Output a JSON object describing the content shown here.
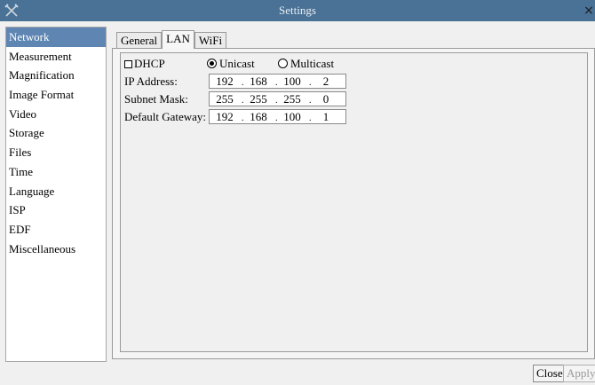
{
  "window": {
    "title": "Settings",
    "icon": "tools-icon",
    "close_icon": "close-icon",
    "close_glyph": "×"
  },
  "sidebar": {
    "items": [
      {
        "label": "Network",
        "selected": true
      },
      {
        "label": "Measurement"
      },
      {
        "label": "Magnification"
      },
      {
        "label": "Image Format"
      },
      {
        "label": "Video"
      },
      {
        "label": "Storage"
      },
      {
        "label": "Files"
      },
      {
        "label": "Time"
      },
      {
        "label": "Language"
      },
      {
        "label": "ISP"
      },
      {
        "label": "EDF"
      },
      {
        "label": "Miscellaneous"
      }
    ]
  },
  "tabs": [
    {
      "label": "General"
    },
    {
      "label": "LAN",
      "active": true
    },
    {
      "label": "WiFi"
    }
  ],
  "lan": {
    "dhcp": {
      "label": "DHCP",
      "checked": false
    },
    "mode": {
      "unicast": {
        "label": "Unicast",
        "selected": true
      },
      "multicast": {
        "label": "Multicast",
        "selected": false
      }
    },
    "ip_address": {
      "label": "IP Address:",
      "octets": [
        "192",
        "168",
        "100",
        "2"
      ]
    },
    "subnet_mask": {
      "label": "Subnet Mask:",
      "octets": [
        "255",
        "255",
        "255",
        "0"
      ]
    },
    "default_gateway": {
      "label": "Default Gateway:",
      "octets": [
        "192",
        "168",
        "100",
        "1"
      ]
    },
    "separator": "."
  },
  "buttons": {
    "close": "Close",
    "apply": "Apply"
  },
  "colors": {
    "titlebar": "#4a7196",
    "selection": "#5f86b3"
  }
}
